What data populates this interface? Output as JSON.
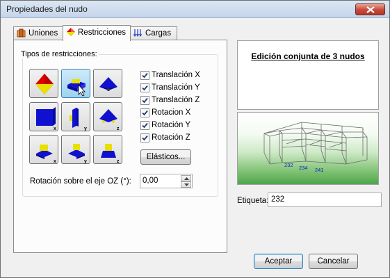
{
  "window": {
    "title": "Propiedades del nudo"
  },
  "tabs": [
    {
      "label": "Uniones",
      "icon": "joint-icon",
      "active": false
    },
    {
      "label": "Restricciones",
      "icon": "restriction-icon",
      "active": true
    },
    {
      "label": "Cargas",
      "icon": "loads-icon",
      "active": false
    }
  ],
  "restrictions": {
    "group_label": "Tipos de restricciones:",
    "types": [
      {
        "name": "fixed",
        "icon": "fixed-support-icon",
        "selected": false
      },
      {
        "name": "pinned",
        "icon": "pinned-support-icon",
        "selected": true
      },
      {
        "name": "roller",
        "icon": "roller-support-icon",
        "selected": false
      },
      {
        "name": "block-x",
        "icon": "block-x-icon",
        "axis": "x",
        "selected": false
      },
      {
        "name": "block-y",
        "icon": "block-y-icon",
        "axis": "y",
        "selected": false
      },
      {
        "name": "roller-z",
        "icon": "roller-z-icon",
        "axis": "z",
        "selected": false
      },
      {
        "name": "slide-x",
        "icon": "slide-x-icon",
        "axis": "x",
        "selected": false
      },
      {
        "name": "slide-y",
        "icon": "slide-y-icon",
        "axis": "y",
        "selected": false
      },
      {
        "name": "slide-z",
        "icon": "slide-z-icon",
        "axis": "z",
        "selected": false
      }
    ],
    "checkboxes": [
      {
        "label": "Translación X",
        "checked": true
      },
      {
        "label": "Translación Y",
        "checked": true
      },
      {
        "label": "Translación Z",
        "checked": true
      },
      {
        "label": "Rotacion X",
        "checked": true
      },
      {
        "label": "Rotación Y",
        "checked": true
      },
      {
        "label": "Rotación Z",
        "checked": true
      }
    ],
    "elastic_button": "Elásticos...",
    "rotation_label": "Rotación sobre el eje OZ (°):",
    "rotation_value": "0,00"
  },
  "info": {
    "title": "Edición conjunta de 3 nudos"
  },
  "preview": {
    "node_labels": [
      "232",
      "234",
      "241"
    ]
  },
  "etiqueta": {
    "label": "Etiqueta:",
    "value": "232"
  },
  "footer": {
    "accept_label": "Aceptar",
    "cancel_label": "Cancelar"
  },
  "colors": {
    "accent": "#3c7fb1",
    "support_blue": "#1010d0",
    "support_yellow": "#e8e000",
    "support_red": "#e00000"
  }
}
